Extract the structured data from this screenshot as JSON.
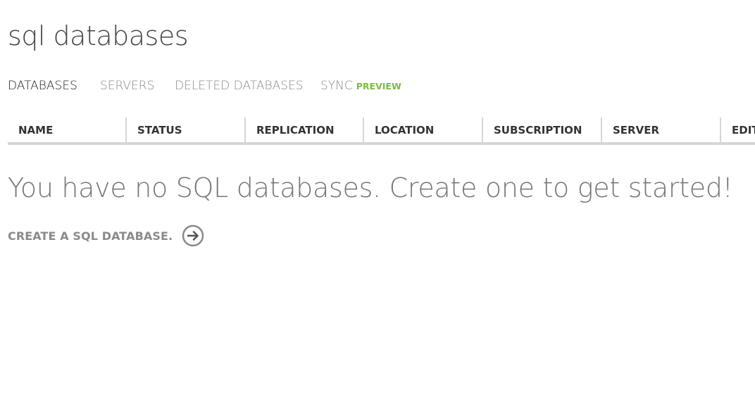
{
  "page": {
    "title": "sql databases"
  },
  "tabs": [
    {
      "label": "DATABASES",
      "active": true
    },
    {
      "label": "SERVERS",
      "active": false
    },
    {
      "label": "DELETED DATABASES",
      "active": false
    },
    {
      "label": "SYNC",
      "badge": "PREVIEW",
      "active": false
    }
  ],
  "grid": {
    "columns": [
      "NAME",
      "STATUS",
      "REPLICATION",
      "LOCATION",
      "SUBSCRIPTION",
      "SERVER",
      "EDITION"
    ]
  },
  "empty_state": {
    "message": "You have no SQL databases. Create one to get started!",
    "create_label": "CREATE A SQL DATABASE.",
    "create_icon": "arrow-circle-right-icon"
  },
  "colors": {
    "accent_badge": "#7cbb3b",
    "muted_text": "#8a8a8a",
    "separator": "#d6d6d6"
  }
}
